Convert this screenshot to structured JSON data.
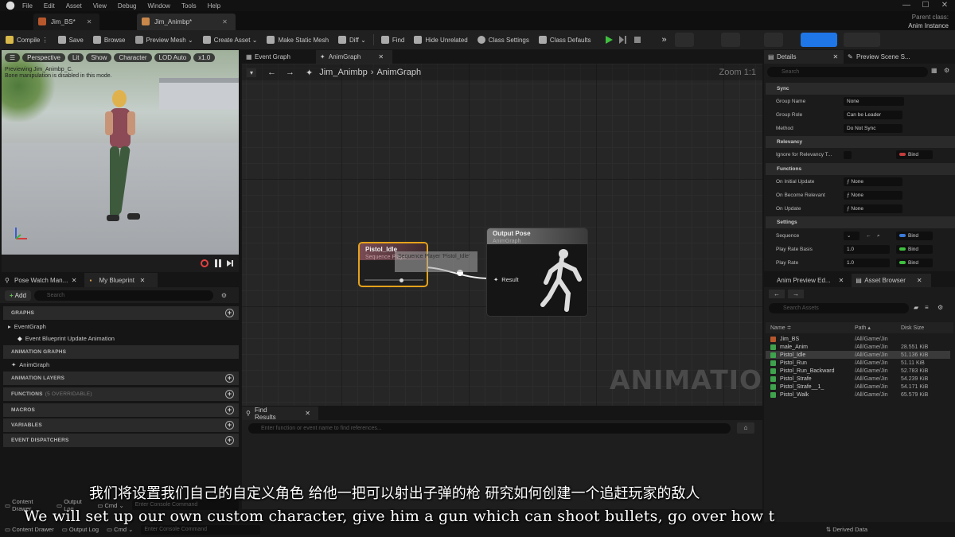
{
  "menu": [
    "File",
    "Edit",
    "Asset",
    "View",
    "Debug",
    "Window",
    "Tools",
    "Help"
  ],
  "doc_tabs": [
    {
      "label": "Jim_BS*",
      "active": false
    },
    {
      "label": "Jim_Animbp*",
      "active": true
    }
  ],
  "parent_class": {
    "label": "Parent class:",
    "value": "Anim Instance"
  },
  "toolbar": {
    "compile": "Compile",
    "save": "Save",
    "browse": "Browse",
    "preview_mesh": "Preview Mesh",
    "create_asset": "Create Asset",
    "make_static_mesh": "Make Static Mesh",
    "diff": "Diff",
    "find": "Find",
    "hide_unrelated": "Hide Unrelated",
    "class_settings": "Class Settings",
    "class_defaults": "Class Defaults"
  },
  "viewport": {
    "perspective": "Perspective",
    "lit": "Lit",
    "show": "Show",
    "character": "Character",
    "lod": "LOD Auto",
    "speed": "x1.0",
    "info_line1": "Previewing Jim_Animbp_C.",
    "info_line2": "Bone manipulation is disabled in this mode."
  },
  "left_tabs": [
    "Pose Watch Man...",
    "My Blueprint"
  ],
  "left_search": {
    "add": "Add",
    "placeholder": "Search"
  },
  "my_blueprint": {
    "graphs": "GRAPHS",
    "event_graph": "EventGraph",
    "event_blueprint": "Event Blueprint Update Animation",
    "animation_graphs": "ANIMATION GRAPHS",
    "anim_graph": "AnimGraph",
    "animation_layers": "ANIMATION LAYERS",
    "functions": "FUNCTIONS",
    "functions_note": "(5 OVERRIDABLE)",
    "macros": "MACROS",
    "variables": "VARIABLES",
    "event_dispatchers": "EVENT DISPATCHERS"
  },
  "graph_tabs": [
    "Event Graph",
    "AnimGraph"
  ],
  "breadcrumb": {
    "root": "Jim_Animbp",
    "child": "AnimGraph"
  },
  "zoom": "Zoom 1:1",
  "watermark": "ANIMATION",
  "node_sequence": {
    "title": "Pistol_Idle",
    "subtitle": "Sequence Player"
  },
  "node_output": {
    "title": "Output Pose",
    "subtitle": "AnimGraph",
    "pin": "Result"
  },
  "tooltip": "Sequence Player 'Pistol_Idle'",
  "find_results": {
    "tab": "Find Results",
    "placeholder": "Enter function or event name to find references..."
  },
  "details_tabs": [
    "Details",
    "Preview Scene S..."
  ],
  "details_search": "Search",
  "details": {
    "sync": "Sync",
    "group_name": "Group Name",
    "group_name_val": "None",
    "group_role": "Group Role",
    "group_role_val": "Can be Leader",
    "method": "Method",
    "method_val": "Do Not Sync",
    "relevancy": "Relevancy",
    "ignore_relevancy": "Ignore for Relevancy T...",
    "bind": "Bind",
    "functions": "Functions",
    "on_initial_update": "On Initial Update",
    "on_become_relevant": "On Become Relevant",
    "on_update": "On Update",
    "none": "None",
    "settings": "Settings",
    "sequence": "Sequence",
    "play_rate_basis": "Play Rate Basis",
    "play_rate_basis_val": "1.0",
    "play_rate": "Play Rate",
    "play_rate_val": "1.0"
  },
  "asset_tabs": [
    "Anim Preview Ed...",
    "Asset Browser"
  ],
  "asset_search": "Search Assets",
  "asset_columns": [
    "Name",
    "Path",
    "Disk Size"
  ],
  "assets": [
    {
      "name": "Jim_BS",
      "path": "/All/Game/Jin",
      "size": ""
    },
    {
      "name": "male_Anim",
      "path": "/All/Game/Jin",
      "size": "28.551 KiB"
    },
    {
      "name": "Pistol_Idle",
      "path": "/All/Game/Jin",
      "size": "51.136 KiB"
    },
    {
      "name": "Pistol_Run",
      "path": "/All/Game/Jin",
      "size": "51.11 KiB"
    },
    {
      "name": "Pistol_Run_Backward",
      "path": "/All/Game/Jin",
      "size": "52.783 KiB"
    },
    {
      "name": "Pistol_Strafe",
      "path": "/All/Game/Jin",
      "size": "54.239 KiB"
    },
    {
      "name": "Pistol_Strafe__1_",
      "path": "/All/Game/Jin",
      "size": "54.171 KiB"
    },
    {
      "name": "Pistol_Walk",
      "path": "/All/Game/Jin",
      "size": "65.579 KiB"
    }
  ],
  "status": {
    "content_drawer": "Content Drawer",
    "output_log": "Output Log",
    "cmd": "Cmd",
    "console_placeholder": "Enter Console Command",
    "derived_data": "Derived Data"
  },
  "subtitles": {
    "chinese": "我们将设置我们自己的自定义角色 给他一把可以射出子弹的枪 研究如何创建一个追赶玩家的敌人",
    "english": "We will set up our own custom character, give him a gun which can shoot bullets, go over how t"
  },
  "colors": {
    "accent": "#e5a21b",
    "play": "#3fbf3f",
    "blue": "#1f76e6"
  }
}
